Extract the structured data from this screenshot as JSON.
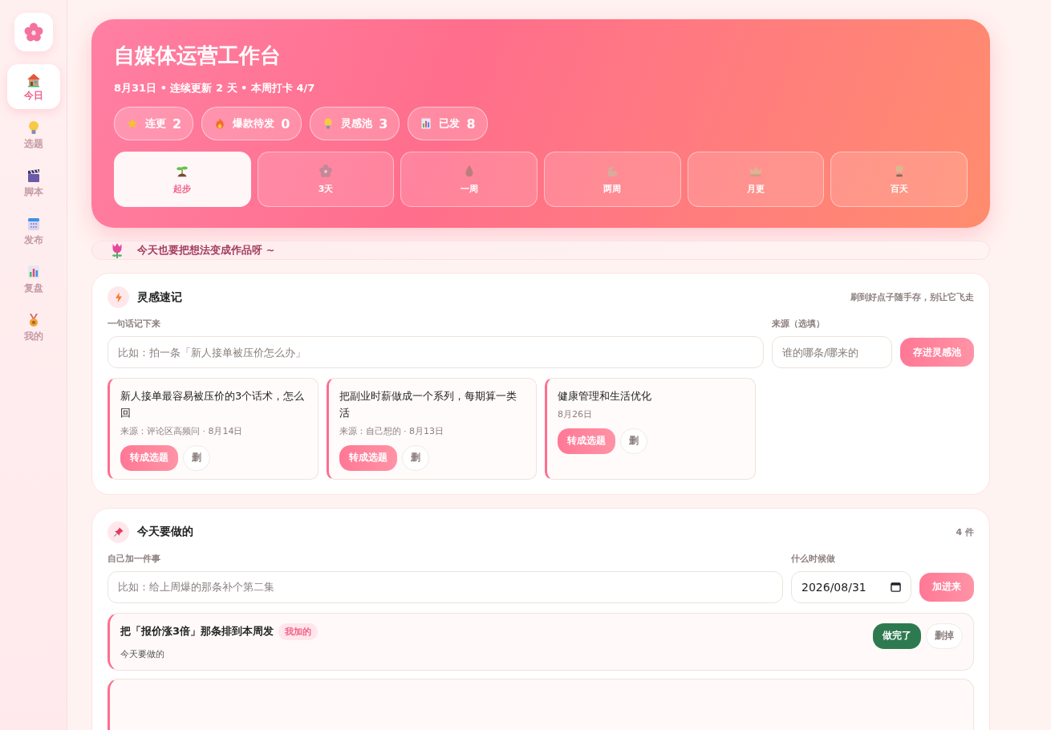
{
  "sidebar": {
    "items": [
      {
        "label": "今日",
        "selected": true
      },
      {
        "label": "选题",
        "selected": false
      },
      {
        "label": "脚本",
        "selected": false
      },
      {
        "label": "发布",
        "selected": false
      },
      {
        "label": "复盘",
        "selected": false
      },
      {
        "label": "我的",
        "selected": false
      }
    ]
  },
  "header": {
    "title": "自媒体运营工作台",
    "subtitle": "8月31日 • 连续更新 2 天 • 本周打卡 4/7",
    "stats": [
      {
        "label": "连更",
        "value": "2"
      },
      {
        "label": "爆款待发",
        "value": "0"
      },
      {
        "label": "灵感池",
        "value": "3"
      },
      {
        "label": "已发",
        "value": "8"
      }
    ],
    "milestones": [
      {
        "label": "起步",
        "selected": true
      },
      {
        "label": "3天",
        "selected": false
      },
      {
        "label": "一周",
        "selected": false
      },
      {
        "label": "两周",
        "selected": false
      },
      {
        "label": "月更",
        "selected": false
      },
      {
        "label": "百天",
        "selected": false
      }
    ]
  },
  "tip": {
    "text": "今天也要把想法变成作品呀 ~"
  },
  "ideas": {
    "title": "灵感速记",
    "hint": "刷到好点子随手存，别让它飞走",
    "idea_label": "一句话记下来",
    "idea_placeholder": "比如：拍一条「新人接单被压价怎么办」",
    "source_label": "来源（选填）",
    "source_placeholder": "谁的哪条/哪来的",
    "save_button": "存进灵感池",
    "cards": [
      {
        "title": "新人接单最容易被压价的3个话术，怎么回",
        "meta": "来源：评论区高频问 · 8月14日",
        "convert_button": "转成选题",
        "delete_button": "删"
      },
      {
        "title": "把副业时薪做成一个系列，每期算一类活",
        "meta": "来源：自己想的 · 8月13日",
        "convert_button": "转成选题",
        "delete_button": "删"
      },
      {
        "title": "健康管理和生活优化",
        "meta": "8月26日",
        "convert_button": "转成选题",
        "delete_button": "删"
      }
    ]
  },
  "todo": {
    "title": "今天要做的",
    "count": "4 件",
    "task_label": "自己加一件事",
    "task_placeholder": "比如：给上周爆的那条补个第二集",
    "date_label": "什么时候做",
    "date_value": "2026/08/31",
    "add_button": "加进来",
    "tasks": [
      {
        "title": "把「报价涨3倍」那条排到本周发",
        "tag": "我加的",
        "note": "今天要做的",
        "done_button": "做完了",
        "delete_button": "删掉"
      }
    ]
  }
}
